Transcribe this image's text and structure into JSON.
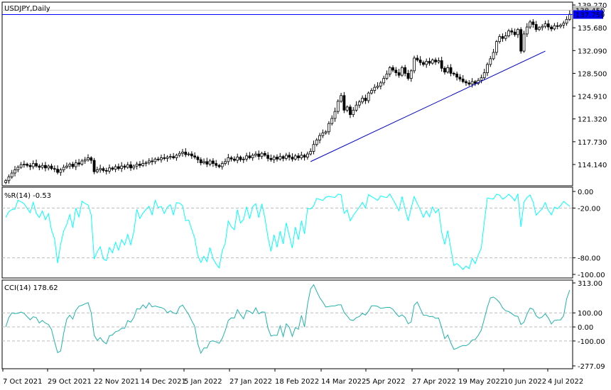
{
  "chart_data": [
    {
      "type": "candlestick",
      "title": "USDJPY,Daily",
      "ylim": [
        111.0,
        139.27
      ],
      "y_ticks": [
        "139.270",
        "135.680",
        "132.090",
        "128.500",
        "124.910",
        "121.320",
        "117.730",
        "114.140"
      ],
      "current_price": 137.759,
      "current_price_label": "137.759",
      "ask_price": 138.45,
      "ask_price_label": "138.450",
      "trendline": {
        "start_index": 100,
        "start_price": 114.6,
        "end_index": 177,
        "end_price": 132.0
      },
      "closes": [
        111.6,
        112.2,
        112.8,
        113.3,
        113.7,
        114.1,
        114.2,
        114.0,
        113.8,
        114.3,
        113.9,
        113.7,
        114.0,
        113.6,
        113.9,
        113.5,
        113.4,
        112.9,
        113.3,
        113.7,
        113.9,
        114.2,
        113.8,
        114.4,
        114.2,
        114.7,
        114.9,
        115.2,
        114.8,
        113.0,
        113.3,
        113.5,
        113.2,
        113.1,
        113.6,
        113.4,
        113.8,
        113.5,
        113.9,
        113.7,
        114.1,
        113.6,
        113.9,
        114.2,
        114.0,
        114.3,
        114.4,
        114.7,
        114.6,
        115.0,
        114.9,
        115.2,
        115.1,
        115.3,
        115.4,
        115.2,
        115.6,
        115.9,
        116.1,
        115.7,
        115.8,
        115.5,
        115.3,
        114.9,
        114.4,
        114.6,
        114.2,
        114.7,
        114.3,
        114.0,
        113.8,
        114.3,
        114.6,
        115.2,
        115.0,
        114.8,
        115.3,
        114.9,
        115.0,
        115.5,
        115.2,
        115.6,
        115.8,
        115.4,
        115.9,
        115.6,
        115.1,
        114.9,
        115.3,
        115.0,
        115.4,
        115.1,
        115.6,
        115.3,
        115.0,
        115.5,
        115.2,
        115.6,
        115.3,
        115.8,
        116.2,
        117.3,
        118.0,
        118.7,
        119.1,
        119.3,
        120.6,
        121.4,
        122.5,
        124.1,
        125.0,
        122.7,
        123.2,
        122.0,
        122.7,
        123.5,
        124.0,
        124.6,
        124.2,
        125.4,
        125.8,
        126.3,
        126.5,
        127.0,
        127.7,
        128.4,
        129.4,
        129.0,
        128.6,
        128.2,
        129.4,
        128.5,
        127.7,
        128.9,
        130.9,
        130.6,
        130.2,
        129.9,
        130.4,
        130.1,
        130.6,
        130.3,
        130.5,
        129.3,
        128.7,
        129.4,
        128.5,
        128.4,
        127.9,
        127.6,
        127.2,
        127.0,
        126.8,
        127.2,
        126.9,
        127.4,
        127.8,
        128.6,
        129.9,
        130.8,
        131.8,
        133.5,
        134.3,
        134.0,
        134.4,
        135.2,
        135.0,
        134.6,
        135.4,
        132.0,
        134.7,
        135.8,
        136.6,
        136.2,
        135.4,
        135.7,
        135.9,
        136.3,
        135.8,
        135.5,
        136.0,
        135.9,
        136.1,
        136.4,
        137.0,
        137.8
      ],
      "x_tick_labels": [
        "7 Oct 2021",
        "29 Oct 2021",
        "22 Nov 2021",
        "14 Dec 2021",
        "5 Jan 2022",
        "27 Jan 2022",
        "18 Feb 2022",
        "14 Mar 2022",
        "5 Apr 2022",
        "27 Apr 2022",
        "19 May 2022",
        "10 Jun 2022",
        "4 Jul 2022"
      ]
    },
    {
      "type": "line",
      "title": "%R(14)",
      "value_label": "-0.53",
      "period": 14,
      "ylim": [
        -100,
        0
      ],
      "y_ticks": [
        "0.00",
        "-20.00",
        "-80.00",
        "-100.00"
      ],
      "levels": [
        -20,
        -80
      ]
    },
    {
      "type": "line",
      "title": "CCI(14)",
      "value_label": "178.62",
      "period": 14,
      "ylim": [
        -277.09,
        313
      ],
      "y_ticks": [
        "313.00",
        "100.00",
        "0.00",
        "-100.00",
        "-277.09"
      ],
      "levels": [
        100,
        0,
        -100
      ]
    }
  ],
  "colors": {
    "candle_up": "#ffffff",
    "candle_down": "#000000",
    "trendline": "#0000cc",
    "price_line": "#0000ff",
    "ask_line": "#c0c0c0",
    "wpr": "#00ffff",
    "cci": "#20b2aa"
  }
}
